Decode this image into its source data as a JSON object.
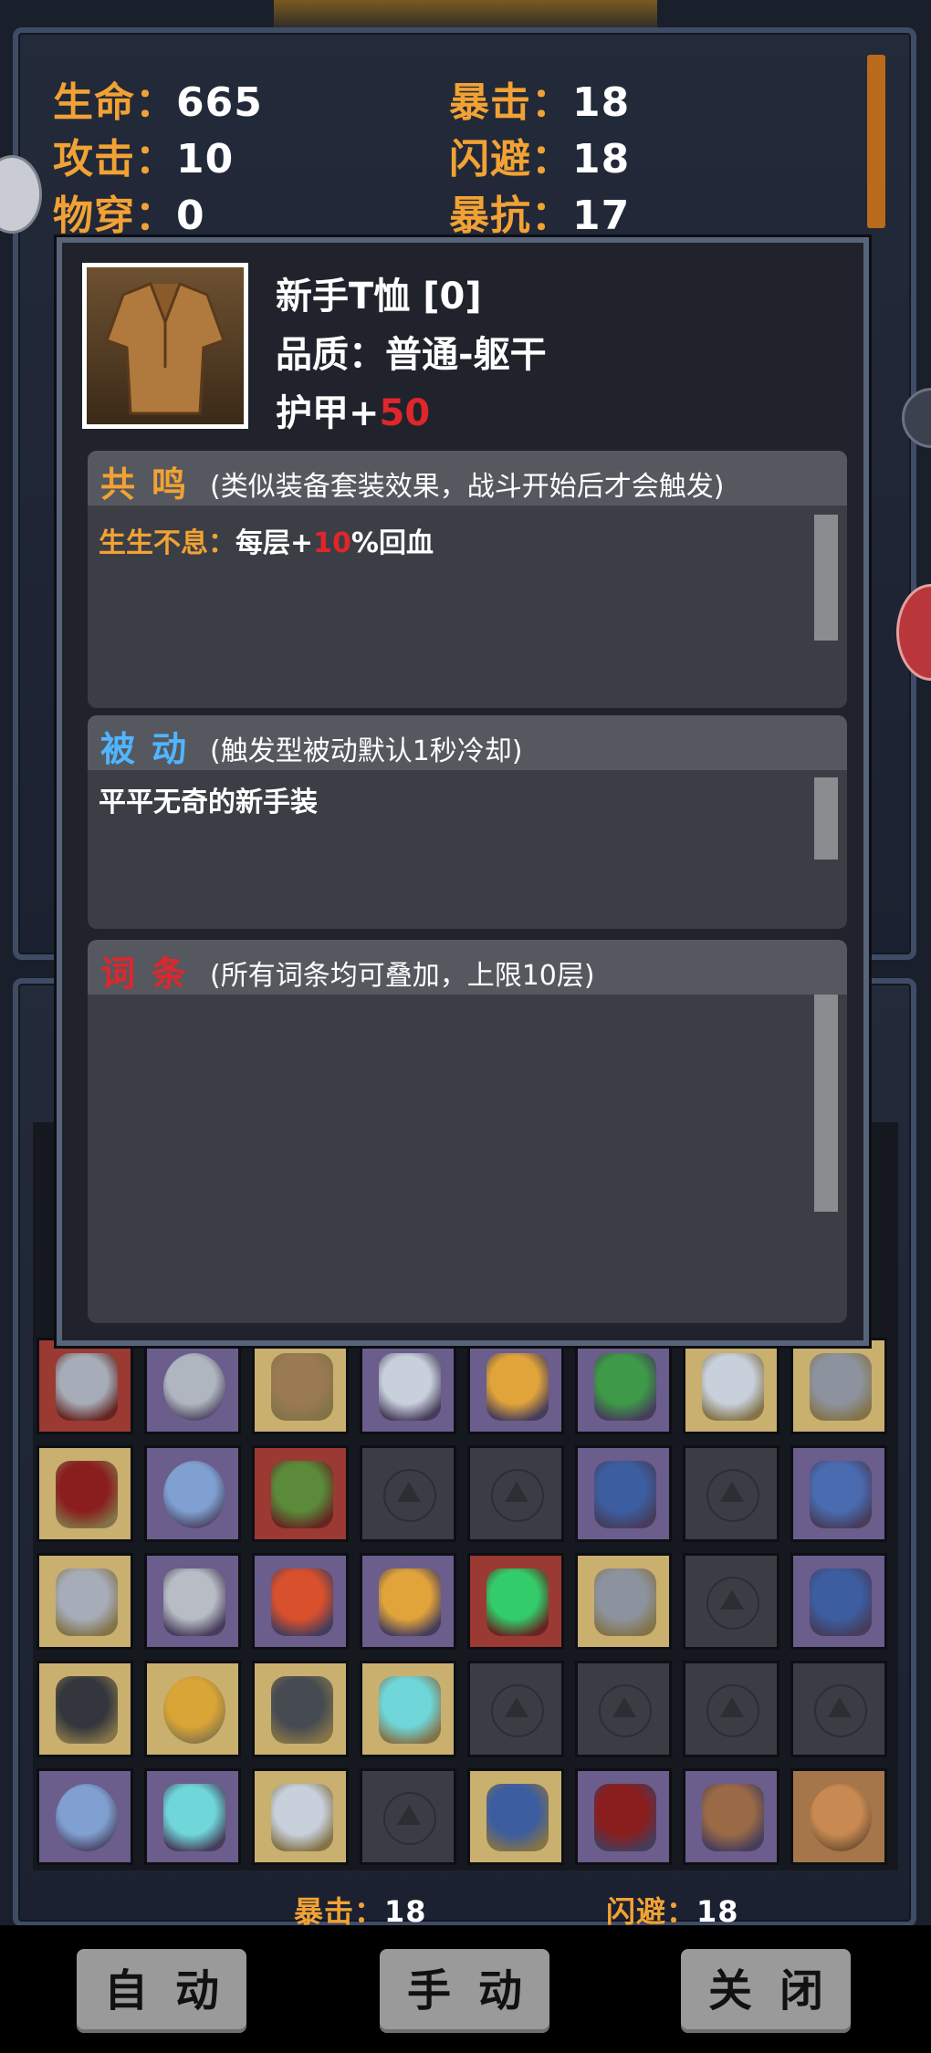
{
  "stats": {
    "hp_label": "生命：",
    "hp": "665",
    "atk_label": "攻击：",
    "atk": "10",
    "pen_label": "物穿：",
    "pen": "0",
    "crit_label": "暴击：",
    "crit": "18",
    "dodge_label": "闪避：",
    "dodge": "18",
    "critres_label": "暴抗：",
    "critres": "17"
  },
  "bottom_stats": {
    "crit_label": "暴击：",
    "crit": "18",
    "dodge_label": "闪避：",
    "dodge": "18"
  },
  "item": {
    "name": "新手T恤 [0]",
    "quality": "品质：普通-躯干",
    "armor_label": "护甲+",
    "armor_value": "50",
    "icon": "tshirt-icon"
  },
  "resonance": {
    "title": "共鸣",
    "subtitle": "(类似装备套装效果，战斗开始后才会触发)",
    "effect_name": "生生不息：",
    "effect_prefix": "每层+",
    "effect_value": "10",
    "effect_suffix": "%回血"
  },
  "passive": {
    "title": "被动",
    "subtitle": "(触发型被动默认1秒冷却)",
    "text": "平平无奇的新手装"
  },
  "affix": {
    "title": "词条",
    "subtitle": "(所有词条均可叠加，上限10层)"
  },
  "buttons": {
    "auto": "自动",
    "manual": "手动",
    "close": "关闭"
  },
  "colors": {
    "stat_label": "#f2a234",
    "resonance_title": "#f2a234",
    "passive_title": "#4fb6ff",
    "affix_title": "#e0262b",
    "highlight": "#e0262b"
  },
  "inventory": [
    [
      {
        "icon": "claw-gauntlet-icon",
        "bg": "red"
      },
      {
        "icon": "ring-icon",
        "bg": "purple"
      },
      {
        "icon": "chainmail-icon",
        "bg": "tan"
      },
      {
        "icon": "sword-icon",
        "bg": "purple"
      },
      {
        "icon": "glove-icon",
        "bg": "purple"
      },
      {
        "icon": "green-armor-icon",
        "bg": "purple"
      },
      {
        "icon": "sword-icon",
        "bg": "tan"
      },
      {
        "icon": "boot-icon",
        "bg": "tan"
      }
    ],
    [
      {
        "icon": "red-cloak-icon",
        "bg": "tan"
      },
      {
        "icon": "blue-gem-ring-icon",
        "bg": "purple"
      },
      {
        "icon": "green-hood-icon",
        "bg": "red"
      },
      {
        "icon": "",
        "bg": "empty"
      },
      {
        "icon": "",
        "bg": "empty"
      },
      {
        "icon": "blue-tunic-icon",
        "bg": "purple"
      },
      {
        "icon": "",
        "bg": "empty"
      },
      {
        "icon": "blue-boot-icon",
        "bg": "purple"
      }
    ],
    [
      {
        "icon": "claw-gauntlet-icon",
        "bg": "tan"
      },
      {
        "icon": "battle-axe-icon",
        "bg": "purple"
      },
      {
        "icon": "fire-wand-icon",
        "bg": "purple"
      },
      {
        "icon": "glove-icon",
        "bg": "purple"
      },
      {
        "icon": "green-amulet-icon",
        "bg": "red"
      },
      {
        "icon": "boot-icon",
        "bg": "tan"
      },
      {
        "icon": "",
        "bg": "empty"
      },
      {
        "icon": "blue-tunic-icon",
        "bg": "purple"
      }
    ],
    [
      {
        "icon": "knight-helmet-icon",
        "bg": "tan"
      },
      {
        "icon": "gold-ring-icon",
        "bg": "tan"
      },
      {
        "icon": "spiked-helmet-icon",
        "bg": "tan"
      },
      {
        "icon": "crystal-wand-icon",
        "bg": "tan"
      },
      {
        "icon": "",
        "bg": "empty"
      },
      {
        "icon": "",
        "bg": "empty"
      },
      {
        "icon": "",
        "bg": "empty"
      },
      {
        "icon": "",
        "bg": "empty"
      }
    ],
    [
      {
        "icon": "blue-gem-ring-icon",
        "bg": "purple"
      },
      {
        "icon": "crystal-wand-icon",
        "bg": "purple"
      },
      {
        "icon": "sword-icon",
        "bg": "tan"
      },
      {
        "icon": "",
        "bg": "empty"
      },
      {
        "icon": "blue-tunic-icon",
        "bg": "tan"
      },
      {
        "icon": "red-cloak-icon",
        "bg": "purple"
      },
      {
        "icon": "leather-pants-icon",
        "bg": "purple"
      },
      {
        "icon": "bronze-ring-icon",
        "bg": "brown"
      }
    ]
  ]
}
